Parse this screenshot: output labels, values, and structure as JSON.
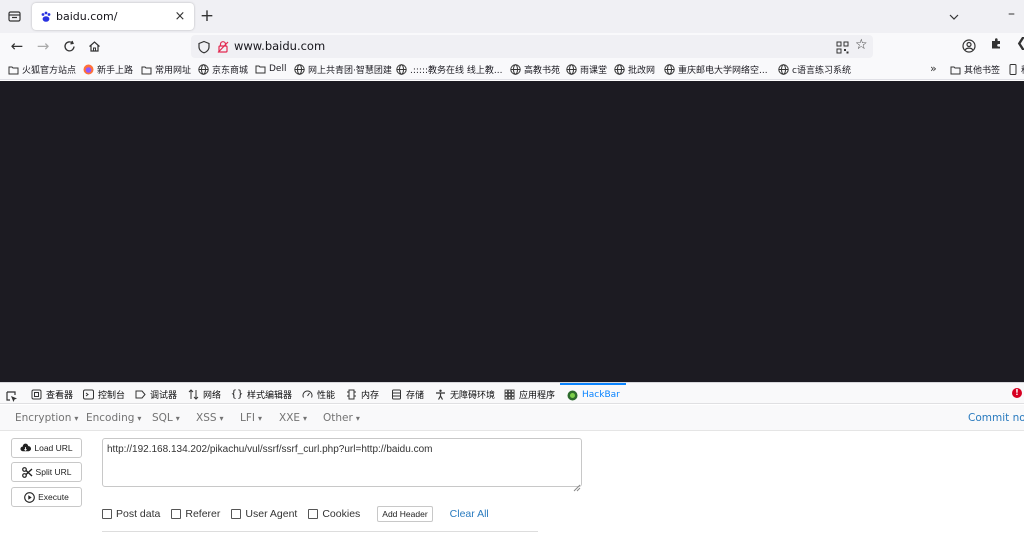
{
  "browser": {
    "tab": {
      "title": "baidu.com/",
      "close_glyph": "×"
    },
    "new_tab_glyph": "+",
    "url": "www.baidu.com",
    "nav": {
      "back": "←",
      "forward": "→",
      "reload": "C",
      "home": "⌂"
    },
    "star_glyph": "☆"
  },
  "bookmarks": {
    "items": [
      {
        "label": "火狐官方站点",
        "icon": "folder-icon"
      },
      {
        "label": "新手上路",
        "icon": "firefox-icon"
      },
      {
        "label": "常用网址",
        "icon": "folder-icon"
      },
      {
        "label": "京东商城",
        "icon": "globe-icon"
      },
      {
        "label": "Dell",
        "icon": "folder-icon"
      },
      {
        "label": "网上共青团·智慧团建",
        "icon": "globe-icon"
      },
      {
        "label": ".:::::教务在线 线上教...",
        "icon": "globe-icon"
      },
      {
        "label": "高教书苑",
        "icon": "globe-icon"
      },
      {
        "label": "雨课堂",
        "icon": "globe-icon"
      },
      {
        "label": "批改网",
        "icon": "globe-icon"
      },
      {
        "label": "重庆邮电大学网络空...",
        "icon": "globe-icon"
      },
      {
        "label": "c语言练习系统",
        "icon": "globe-icon"
      }
    ],
    "overflow": "»",
    "other_label": "其他书签",
    "mobile_label": "移"
  },
  "devtools": {
    "tabs": [
      {
        "label": "查看器",
        "icon": "inspector-icon"
      },
      {
        "label": "控制台",
        "icon": "console-icon"
      },
      {
        "label": "调试器",
        "icon": "debugger-icon"
      },
      {
        "label": "网络",
        "icon": "network-icon"
      },
      {
        "label": "样式编辑器",
        "icon": "style-editor-icon"
      },
      {
        "label": "性能",
        "icon": "performance-icon"
      },
      {
        "label": "内存",
        "icon": "memory-icon"
      },
      {
        "label": "存储",
        "icon": "storage-icon"
      },
      {
        "label": "无障碍环境",
        "icon": "accessibility-icon"
      },
      {
        "label": "应用程序",
        "icon": "application-icon"
      },
      {
        "label": "HackBar",
        "icon": "hackbar-icon"
      }
    ],
    "active_tab": "HackBar",
    "error_glyph": "!"
  },
  "hackbar": {
    "menu": [
      {
        "label": "Encryption"
      },
      {
        "label": "Encoding"
      },
      {
        "label": "SQL"
      },
      {
        "label": "XSS"
      },
      {
        "label": "LFI"
      },
      {
        "label": "XXE"
      },
      {
        "label": "Other"
      }
    ],
    "caret": "▾",
    "commit_label": "Commit now",
    "buttons": {
      "load": "Load URL",
      "split": "Split URL",
      "execute": "Execute"
    },
    "url_value": "http://192.168.134.202/pikachu/vul/ssrf/ssrf_curl.php?url=http://baidu.com",
    "options": {
      "post": "Post data",
      "referer": "Referer",
      "user_agent": "User Agent",
      "cookies": "Cookies"
    },
    "add_header": "Add Header",
    "clear_all": "Clear All"
  },
  "colors": {
    "viewport_bg": "#1c1b22",
    "accent": "#0a84ff",
    "link": "#2a7bbf"
  }
}
